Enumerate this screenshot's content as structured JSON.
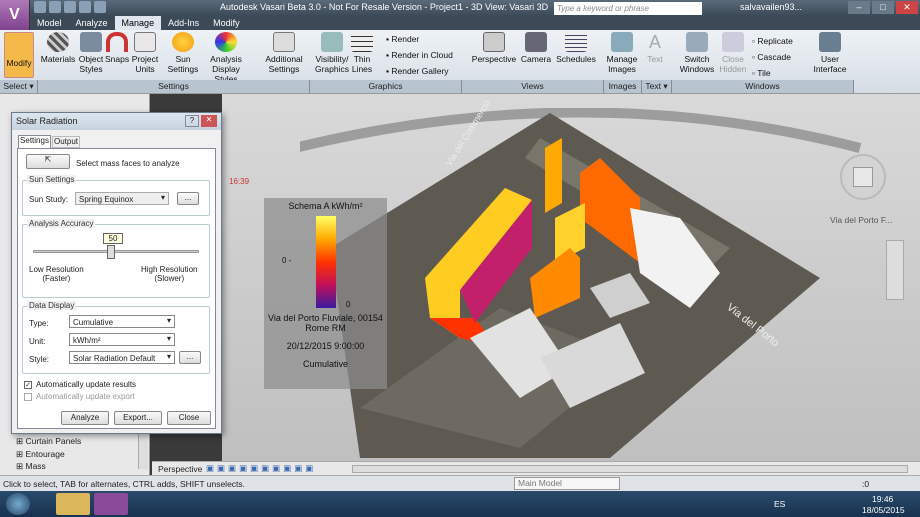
{
  "window": {
    "title": "Autodesk Vasari Beta 3.0 - Not For Resale Version -   Project1 - 3D View: Vasari 3D",
    "search_placeholder": "Type a keyword or phrase",
    "user": "salvavailen93..."
  },
  "tabs": [
    "Model",
    "Analyze",
    "Manage",
    "Add-Ins",
    "Modify"
  ],
  "active_tab": "Manage",
  "ribbon": {
    "tools": {
      "modify": "Modify",
      "materials": "Materials",
      "object_styles": "Object Styles",
      "snaps": "Snaps",
      "project_units": "Project Units",
      "sun_settings": "Sun Settings",
      "analysis_display_styles": "Analysis Display Styles",
      "additional_settings": "Additional Settings",
      "visibility_graphics": "Visibility/ Graphics",
      "thin_lines": "Thin Lines",
      "render": "Render",
      "render_cloud": "Render  in Cloud",
      "render_gallery": "Render  Gallery",
      "perspective": "Perspective",
      "camera": "Camera",
      "schedules": "Schedules",
      "manage_images": "Manage Images",
      "text": "Text",
      "switch_windows": "Switch Windows",
      "close_hidden": "Close Hidden",
      "replicate": "Replicate",
      "cascade": "Cascade",
      "tile": "Tile",
      "user_interface": "User Interface"
    },
    "groups": {
      "select": "Select ▾",
      "settings": "Settings",
      "graphics": "Graphics",
      "views": "Views",
      "images": "Images",
      "text": "Text ▾",
      "windows": "Windows"
    }
  },
  "dialog": {
    "title": "Solar Radiation",
    "tab_settings": "Settings",
    "tab_output": "Output",
    "select_faces": "Select mass faces to analyze",
    "sun_settings_label": "Sun Settings",
    "sun_study_label": "Sun Study:",
    "sun_study_value": "Spring Equinox",
    "browse": "...",
    "accuracy_label": "Analysis Accuracy",
    "accuracy_value": "50",
    "low_res": "Low Resolution",
    "low_res_sub": "(Faster)",
    "high_res": "High Resolution",
    "high_res_sub": "(Slower)",
    "data_display_label": "Data Display",
    "type_label": "Type:",
    "type_value": "Cumulative",
    "unit_label": "Unit:",
    "unit_value": "kWh/m²",
    "style_label": "Style:",
    "style_value": "Solar Radiation Default",
    "auto_update_results": "Automatically update results",
    "auto_update_export": "Automatically update export",
    "analyze": "Analyze",
    "export": "Export...",
    "close": "Close"
  },
  "legend": {
    "title": "Schema A   kWh/m²",
    "mid_label": "0 -",
    "zero": "0",
    "address": "Via del Porto Fluviale, 00154 Rome RM",
    "datetime": "20/12/2015 9:00:00",
    "mode": "Cumulative"
  },
  "viewport": {
    "time": "16:39",
    "street1": "Via del Commercio",
    "street2": "Via del Porto",
    "view_label": "Via del Porto F..."
  },
  "tree": {
    "items": [
      "Curtain Panels",
      "Entourage",
      "Mass"
    ]
  },
  "viewbar": {
    "label": "Perspective"
  },
  "status": {
    "hint": "Click to select, TAB for alternates, CTRL adds, SHIFT unselects.",
    "model": "Main Model",
    "filter": ":0"
  },
  "taskbar": {
    "lang": "ES",
    "time": "19:46",
    "date": "18/05/2015"
  }
}
